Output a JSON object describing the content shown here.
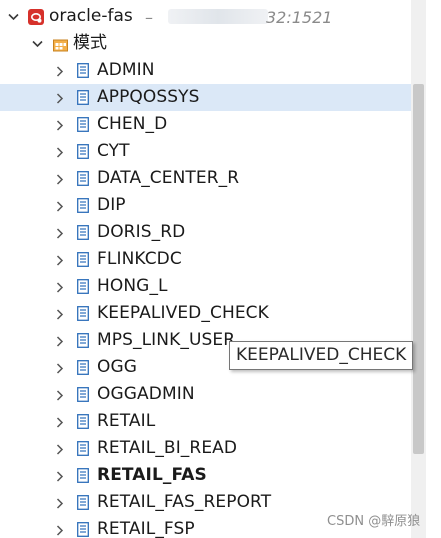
{
  "connection": {
    "name": "oracle-fas",
    "separator": "–",
    "host_end": "32:1521"
  },
  "folder": {
    "label": "模式"
  },
  "schemas": [
    {
      "label": "ADMIN"
    },
    {
      "label": "APPQOSSYS",
      "selected": true
    },
    {
      "label": "CHEN_D"
    },
    {
      "label": "CYT"
    },
    {
      "label": "DATA_CENTER_R"
    },
    {
      "label": "DIP"
    },
    {
      "label": "DORIS_RD"
    },
    {
      "label": "FLINKCDC"
    },
    {
      "label": "HONG_L"
    },
    {
      "label": "KEEPALIVED_CHECK"
    },
    {
      "label": "MPS_LINK_USER"
    },
    {
      "label": "OGG"
    },
    {
      "label": "OGGADMIN"
    },
    {
      "label": "RETAIL"
    },
    {
      "label": "RETAIL_BI_READ"
    },
    {
      "label": "RETAIL_FAS",
      "bold": true
    },
    {
      "label": "RETAIL_FAS_REPORT"
    },
    {
      "label": "RETAIL_FSP"
    }
  ],
  "tooltip": {
    "text": "KEEPALIVED_CHECK"
  },
  "watermark": "CSDN @騂原狼",
  "colors": {
    "selected_row": "#dbe8f7",
    "oracle_icon": "#d6312b",
    "schema_icon": "#2f6fba",
    "folder_icon": "#e8a13a"
  },
  "icons": {
    "expand": "chevron-down-icon",
    "collapsed": "chevron-right-icon",
    "schema": "schema-icon",
    "folder": "folder-icon",
    "db": "oracle-db-icon"
  }
}
